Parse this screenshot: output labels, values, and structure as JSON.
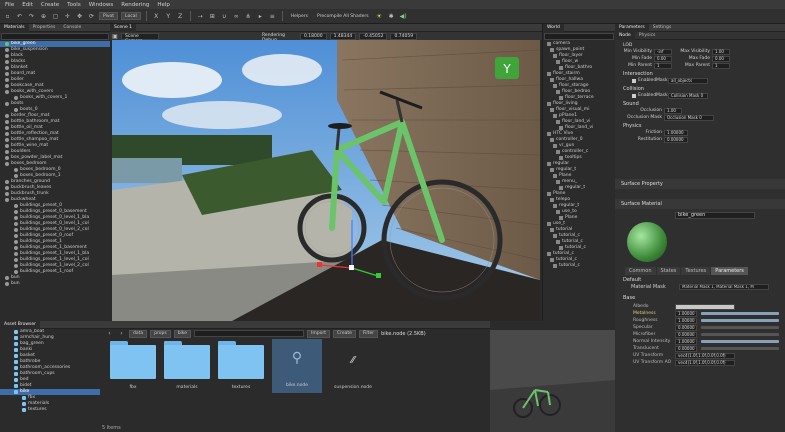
{
  "menu": [
    "File",
    "Edit",
    "Create",
    "Tools",
    "Windows",
    "Rendering",
    "Help"
  ],
  "toolbar": {
    "pivot": "Pivot",
    "local": "Local",
    "helpers": "Helpers",
    "precompile": "Precompile All Shaders"
  },
  "left_panel": {
    "tabs": [
      "Materials",
      "Properties",
      "Console"
    ],
    "items": [
      "bike_green",
      "bike_suspension",
      "black",
      "blacks",
      "blanket",
      "board_mat",
      "boiler",
      "bookcase_mat",
      "books_with_covers",
      "books_with_covers_1",
      "boots",
      "boots_0",
      "border_floor_mat",
      "bottle_bathroom_mat",
      "bottle_oil_mat",
      "bottle_reflection_mat",
      "bottle_shampoo_mat",
      "bottle_wine_mat",
      "boulders",
      "box_powder_label_mat",
      "boxes_bedroom",
      "boxes_bedroom_0",
      "boxes_bedroom_1",
      "branches_ground",
      "buckbrush_leaves",
      "buckbrush_trunk",
      "buckwheat",
      "buildings_preset_0",
      "buildings_preset_0_basement",
      "buildings_preset_0_level_1_bla",
      "buildings_preset_0_level_1_col",
      "buildings_preset_0_level_2_col",
      "buildings_preset_0_roof",
      "buildings_preset_1",
      "buildings_preset_1_basement",
      "buildings_preset_1_level_1_bla",
      "buildings_preset_1_level_1_col",
      "buildings_preset_1_level_2_col",
      "buildings_preset_1_roof",
      "bun",
      "bun"
    ]
  },
  "viewport": {
    "tab": "Scene 1",
    "camera": "Scene Camera",
    "debug": "Rendering Debug",
    "v1": "0.18000",
    "v2": "1.48344",
    "v3": "-0.45052",
    "v4": "0.74059"
  },
  "world": {
    "tab": "World",
    "items": [
      "camera",
      "spawn_point",
      "floor_layer",
      "floor_w",
      "floor_bathro",
      "floor_stairm",
      "floor_hallwa",
      "floor_storage",
      "floor_bedroo",
      "floor_terrace",
      "floor_living",
      "floor_visual_mi",
      "pPlane1",
      "floor_land_vi",
      "floor_land_vi",
      "HTC Vive",
      "controller_0",
      "vr_gun",
      "controller_c",
      "tooltips",
      "regular",
      "regular_t",
      "Plane",
      "menu_",
      "regular_t",
      "Plane",
      "telepo",
      "regular_t",
      "use_to",
      "Plane",
      "use_t",
      "tutorial",
      "tutorial_c",
      "tutorial_c",
      "tutorial_c",
      "tutorial_c",
      "tutorial_c",
      "tutorial_c"
    ]
  },
  "right_panel": {
    "tabs": [
      "Parameters",
      "Settings"
    ],
    "subtabs": [
      "Node",
      "Physics"
    ],
    "lod": {
      "title": "LOD",
      "min_vis_label": "Min Visibility",
      "min_vis": "-inf",
      "max_vis_label": "Max Visibility",
      "max_vis": "1.00",
      "min_fade_label": "Min Fade",
      "min_fade": "0.00",
      "max_fade_label": "Max Fade",
      "max_fade": "0.00",
      "min_parent_label": "Min Parent",
      "min_parent": "1",
      "max_parent_label": "Max Parent",
      "max_parent": "1"
    },
    "intersection": {
      "title": "Intersection",
      "enabled": "Enabled",
      "mask_label": "Mask",
      "mask": "all_objects"
    },
    "collision": {
      "title": "Collision",
      "enabled": "Enabled",
      "mask_label": "Mask",
      "mask": "Collision Mask 0"
    },
    "sound": {
      "title": "Sound",
      "occlusion_label": "Occlusion",
      "occlusion": "1.00",
      "occ_mask_label": "Occlusion Mask",
      "occ_mask": "Occlusion Mask 0"
    },
    "physics": {
      "title": "Physics",
      "friction_label": "Friction",
      "friction": "1.00000",
      "restitution_label": "Restitution",
      "restitution": "0.00000"
    },
    "surface_property": "Surface Property",
    "surface_material": "Surface Material",
    "material_name": "bike_green",
    "mat_tabs": [
      "Common",
      "States",
      "Textures",
      "Parameters"
    ],
    "default_label": "Default",
    "material_mask_label": "Material Mask",
    "material_mask": "Material Mask 1, Material Mask 1, M",
    "base_label": "Base",
    "params": [
      {
        "label": "Albedo",
        "value": ""
      },
      {
        "label": "Metalness",
        "value": "1.00000"
      },
      {
        "label": "Roughness",
        "value": "1.00000"
      },
      {
        "label": "Specular",
        "value": "0.00000"
      },
      {
        "label": "Microfiber",
        "value": "0.00000"
      },
      {
        "label": "Normal Intensity",
        "value": "1.00000"
      },
      {
        "label": "Translucent",
        "value": "0.00000"
      },
      {
        "label": "UV Transform",
        "value": "vec4(1.0f,1.0f,0.0f,0.0f)"
      },
      {
        "label": "UV Transform AO",
        "value": "vec4(1.0f,1.0f,0.0f,0.0f)"
      }
    ],
    "param_levels": [
      0,
      1,
      1,
      0,
      0,
      1,
      0
    ]
  },
  "asset_browser": {
    "title": "Asset Browser",
    "crumbs": [
      "data",
      "props",
      "bike"
    ],
    "import": "Import",
    "create": "Create",
    "filter": "Filter",
    "file_info": "bike.node (2.5KB)",
    "status": "5 items",
    "tree": [
      "amra_boat",
      "armchair_hung",
      "bag_green",
      "banki",
      "basket",
      "bathrobe",
      "bathroom_accessories",
      "bathroom_cups",
      "bed",
      "bidet",
      "bike",
      "fbx",
      "materials",
      "textures"
    ],
    "files": [
      "fbx",
      "materials",
      "textures",
      "bike.node",
      "suspension.node"
    ]
  },
  "gizmo_label": "Y"
}
